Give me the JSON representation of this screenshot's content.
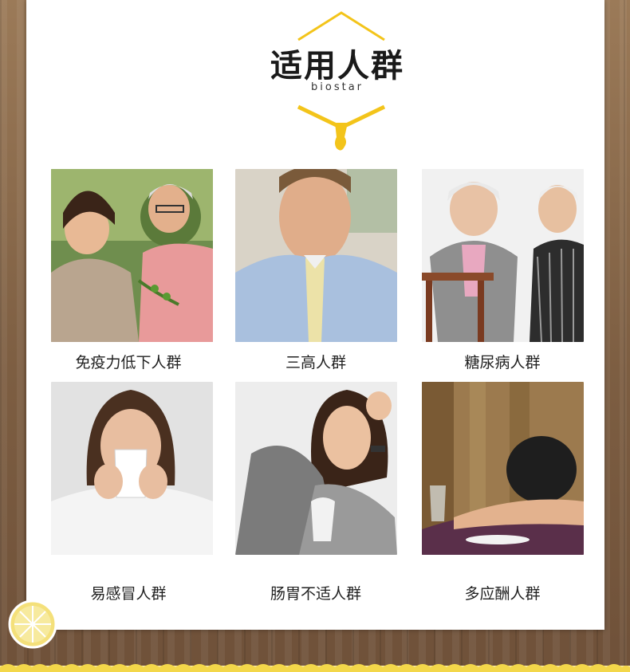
{
  "header": {
    "title": "适用人群",
    "brand": "biostar"
  },
  "groups": [
    {
      "label": "免疫力低下人群",
      "icon": "elderly-couple-gardening-photo"
    },
    {
      "label": "三高人群",
      "icon": "man-in-distress-photo"
    },
    {
      "label": "糖尿病人群",
      "icon": "elderly-couple-reading-photo"
    },
    {
      "label": "易感冒人群",
      "icon": "woman-sneezing-photo"
    },
    {
      "label": "肠胃不适人群",
      "icon": "woman-stomach-pain-photo"
    },
    {
      "label": "多应酬人群",
      "icon": "man-drunk-at-table-photo"
    }
  ],
  "colors": {
    "accent_yellow": "#f3c41a",
    "panel": "#ffffff",
    "wood": "#8a6a4c"
  }
}
